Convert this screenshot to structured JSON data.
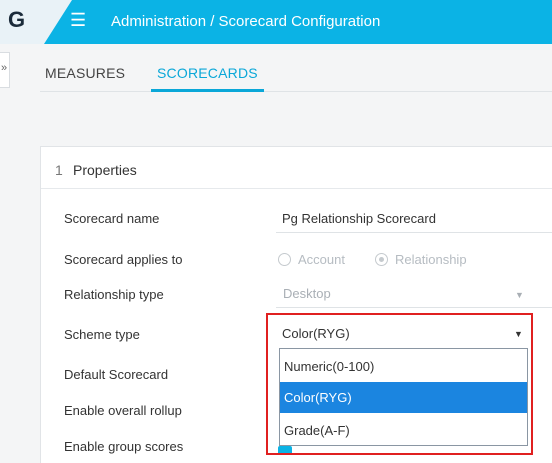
{
  "header": {
    "logo": "G",
    "title": "Administration / Scorecard Configuration"
  },
  "side_toggle": "»",
  "tabs": [
    {
      "label": "MEASURES",
      "active": false
    },
    {
      "label": "SCORECARDS",
      "active": true
    }
  ],
  "panel": {
    "number": "1",
    "title": "Properties",
    "fields": {
      "scorecard_name": {
        "label": "Scorecard name",
        "value": "Pg Relationship Scorecard"
      },
      "applies_to": {
        "label": "Scorecard applies to",
        "options": [
          {
            "label": "Account",
            "selected": false
          },
          {
            "label": "Relationship",
            "selected": true
          }
        ]
      },
      "relationship_type": {
        "label": "Relationship type",
        "value": "Desktop"
      },
      "scheme_type": {
        "label": "Scheme type",
        "value": "Color(RYG)"
      },
      "default_scorecard": {
        "label": "Default Scorecard"
      },
      "enable_overall_rollup": {
        "label": "Enable overall rollup"
      },
      "enable_group_scores": {
        "label": "Enable group scores",
        "checked": true
      }
    }
  },
  "scheme_dropdown": {
    "options": [
      "Numeric(0-100)",
      "Color(RYG)",
      "Grade(A-F)"
    ],
    "selected": "Color(RYG)"
  },
  "colors": {
    "accent": "#0bb3e5",
    "selected_option": "#1b85e0",
    "highlight": "#e02020"
  }
}
